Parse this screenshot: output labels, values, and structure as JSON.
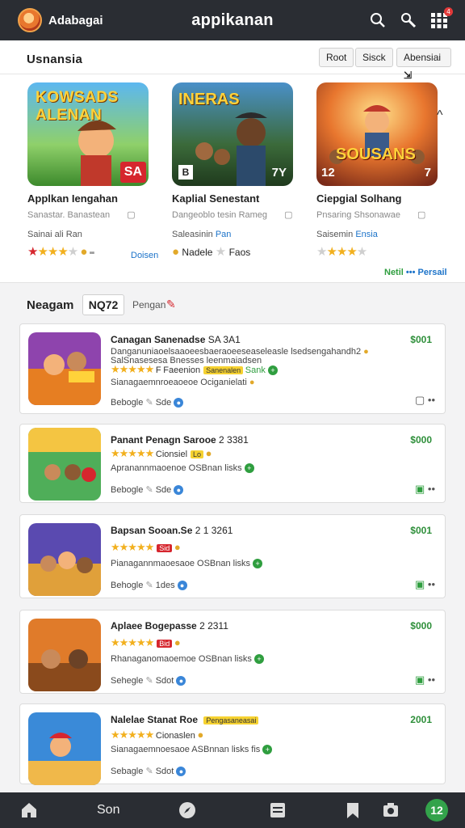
{
  "header": {
    "user": "Adabagai",
    "brand": "appikanan",
    "notif_badge": "4"
  },
  "featured_section": {
    "title": "Usnansia",
    "buttons": [
      "Root",
      "Sisck",
      "Abensiai"
    ],
    "items": [
      {
        "name": "Applkan Iengahan",
        "sub_a": "Sanastar.",
        "sub_b": "Banastean",
        "meta_a": "Sainai ali",
        "meta_b": "Ran",
        "side": "Doisen",
        "image_text": "KOWSADS ALENAN",
        "badge": "SA"
      },
      {
        "name": "Kaplial Senestant",
        "sub_a": "Dangeoblo",
        "sub_b": "tesin Rameg",
        "meta_a": "Saleasinin",
        "meta_b": "Pan",
        "side_a": "Nadele",
        "side_b": "Faos",
        "image_text": "INERAS",
        "badge": "7Y",
        "badge_b": "B"
      },
      {
        "name": "Ciepgial Solhang",
        "sub_a": "Pnsaring",
        "sub_b": "Shsonawae",
        "meta_a": "Saisemin",
        "meta_b": "Ensia",
        "side": "Netil",
        "side_b": "Persail",
        "image_text": "SOUSANS",
        "badge": "12",
        "badge_b": "7"
      }
    ]
  },
  "list_section": {
    "title": "Neagam",
    "box": "NQ72",
    "label": "Pengan"
  },
  "list_items": [
    {
      "title": "Canagan Sanenadse",
      "title_suffix": "SA 3A1",
      "line1": "Danganuniaoelsaaoeesbaeraoeeseaseleasle lsedsengahandh2",
      "line2": "SalSnasesesa Bnesses leenmaiadsen",
      "tag_a": "F",
      "tag_b": "Faeenion",
      "tag_c": "Sanenalen",
      "note_b": "Sank",
      "line3": "Sianagaemnroeaoeoe Ociganielati",
      "dev": "Bebogle",
      "dev_b": "Sde",
      "price": "$001"
    },
    {
      "title": "Panant Penagn Sarooe",
      "title_suffix": "2 3381",
      "line1": "",
      "line2": "",
      "tag_a": "Lo",
      "tag_b": "Cionsiel",
      "tag_c": "",
      "note_b": "",
      "line3": "Apranannmaoenoe OSBnan lisks",
      "dev": "Bebogle",
      "dev_b": "Sde",
      "price": "$000"
    },
    {
      "title": "Bapsan Sooan.Se",
      "title_suffix": "2 1 3261",
      "line1": "",
      "line2": "",
      "tag_a": "Sid",
      "tag_b": "",
      "tag_c": "",
      "note_b": "",
      "line3": "Pianagannmaoesaoe OSBnan lisks",
      "dev": "Behogle",
      "dev_b": "1des",
      "price": "$001"
    },
    {
      "title": "Aplaee Bogepasse",
      "title_suffix": "2 2311",
      "line1": "",
      "line2": "",
      "tag_a": "Bid",
      "tag_b": "",
      "tag_c": "",
      "note_b": "",
      "line3": "Rhanaganomaoemoe OSBnan lisks",
      "dev": "Sehegle",
      "dev_b": "Sdot",
      "price": "$000"
    },
    {
      "title": "Nalelae Stanat Roe",
      "title_suffix": "Pengasaneasai",
      "line1": "",
      "line2": "",
      "tag_a": "",
      "tag_b": "Cionaslen",
      "tag_c": "",
      "note_b": "",
      "line3": "Sianagaemnoesaoe ASBnnan lisks fis",
      "dev": "Sebagle",
      "dev_b": "Sdot",
      "price": "2001"
    }
  ],
  "bottom": {
    "label": "Son",
    "badge": "12"
  }
}
